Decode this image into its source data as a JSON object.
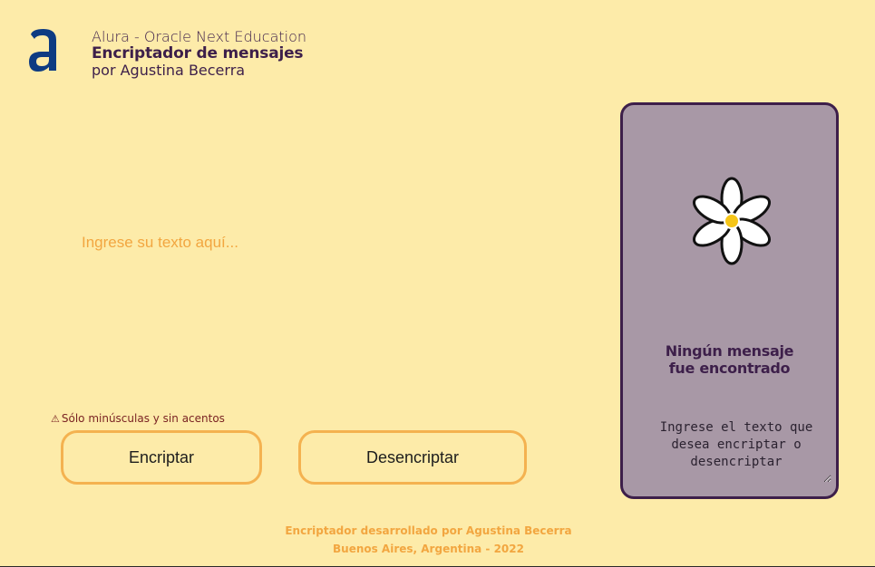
{
  "header": {
    "line1": "Alura - Oracle Next Education",
    "line2": "Encriptador de mensajes",
    "line3": "por Agustina Becerra",
    "logo_icon": "alura-logo-icon",
    "logo_color": "#0d3b82"
  },
  "input": {
    "placeholder": "Ingrese su texto aquí..."
  },
  "warning": {
    "icon": "warning-icon",
    "text": "Sólo minúsculas y sin acentos"
  },
  "buttons": {
    "encrypt_label": "Encriptar",
    "decrypt_label": "Desencriptar",
    "border_color": "#f4b250"
  },
  "output": {
    "image_icon": "daisy-icon",
    "title_line1": "Ningún mensaje",
    "title_line2": "fue encontrado",
    "placeholder": "Ingrese el texto que desea encriptar o desencriptar",
    "panel_color": "#a898a6",
    "border_color": "#3d1f4a"
  },
  "footer": {
    "line1": "Encriptador desarrollado por Agustina Becerra",
    "line2": "Buenos Aires, Argentina - 2022"
  },
  "colors": {
    "background": "#fdeba9",
    "accent": "#f2a640",
    "text_dark": "#3d1f4a"
  }
}
